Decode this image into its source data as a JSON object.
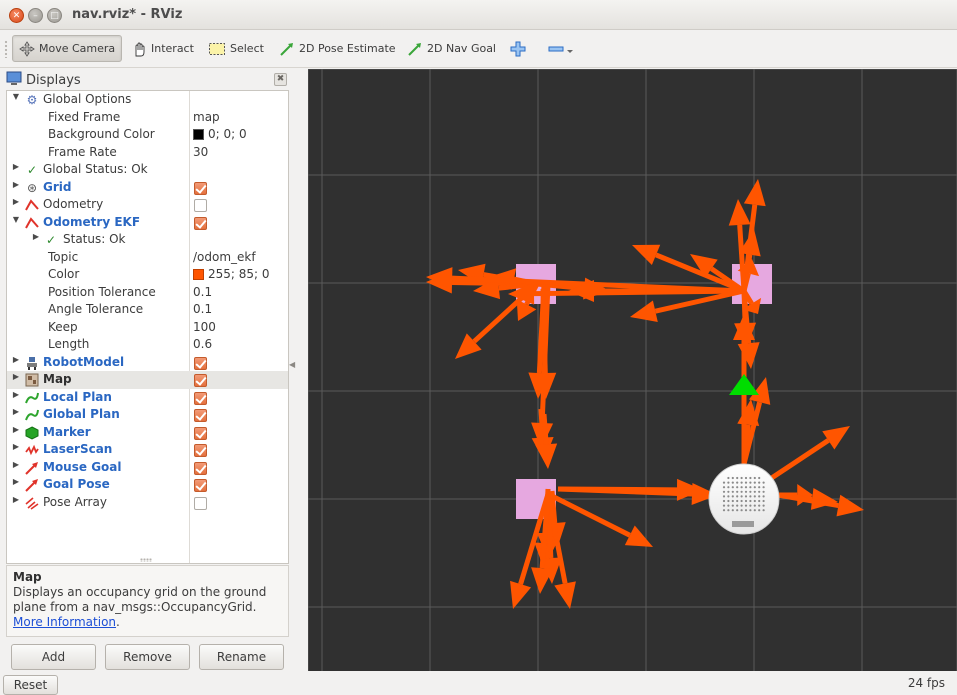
{
  "window": {
    "title": "nav.rviz* - RViz",
    "close_glyph": "✕",
    "min_glyph": "–",
    "max_glyph": "□"
  },
  "toolbar": {
    "move_camera": "Move Camera",
    "interact": "Interact",
    "select": "Select",
    "pose_estimate": "2D Pose Estimate",
    "nav_goal": "2D Nav Goal"
  },
  "displays_panel": {
    "title": "Displays",
    "rows": [
      {
        "label": "Global Options",
        "value": ""
      },
      {
        "label": "Fixed Frame",
        "value": "map"
      },
      {
        "label": "Background Color",
        "value": "0; 0; 0",
        "swatch": "#000000"
      },
      {
        "label": "Frame Rate",
        "value": "30"
      },
      {
        "label": "Global Status: Ok",
        "value": ""
      },
      {
        "label": "Grid",
        "checked": true
      },
      {
        "label": "Odometry",
        "checked": false
      },
      {
        "label": "Odometry EKF",
        "checked": true
      },
      {
        "label": "Status: Ok",
        "value": ""
      },
      {
        "label": "Topic",
        "value": "/odom_ekf"
      },
      {
        "label": "Color",
        "value": "255; 85; 0",
        "swatch": "#ff5500"
      },
      {
        "label": "Position Tolerance",
        "value": "0.1"
      },
      {
        "label": "Angle Tolerance",
        "value": "0.1"
      },
      {
        "label": "Keep",
        "value": "100"
      },
      {
        "label": "Length",
        "value": "0.6"
      },
      {
        "label": "RobotModel",
        "checked": true
      },
      {
        "label": "Map",
        "checked": true
      },
      {
        "label": "Local Plan",
        "checked": true
      },
      {
        "label": "Global Plan",
        "checked": true
      },
      {
        "label": "Marker",
        "checked": true
      },
      {
        "label": "LaserScan",
        "checked": true
      },
      {
        "label": "Mouse Goal",
        "checked": true
      },
      {
        "label": "Goal Pose",
        "checked": true
      },
      {
        "label": "Pose Array",
        "checked": false
      }
    ]
  },
  "help": {
    "title": "Map",
    "body": "Displays an occupancy grid on the ground plane from a nav_msgs::OccupancyGrid.",
    "link": "More Information",
    "link_suffix": "."
  },
  "buttons": {
    "add": "Add",
    "remove": "Remove",
    "rename": "Rename",
    "reset": "Reset"
  },
  "status": {
    "fps": "24 fps"
  },
  "viewport": {
    "background": "#303030",
    "grid_color": "#5a5a5a",
    "arrow_color": "#ff5500",
    "marker_color": "#e6a8e0",
    "pose_color": "#00dd00"
  }
}
